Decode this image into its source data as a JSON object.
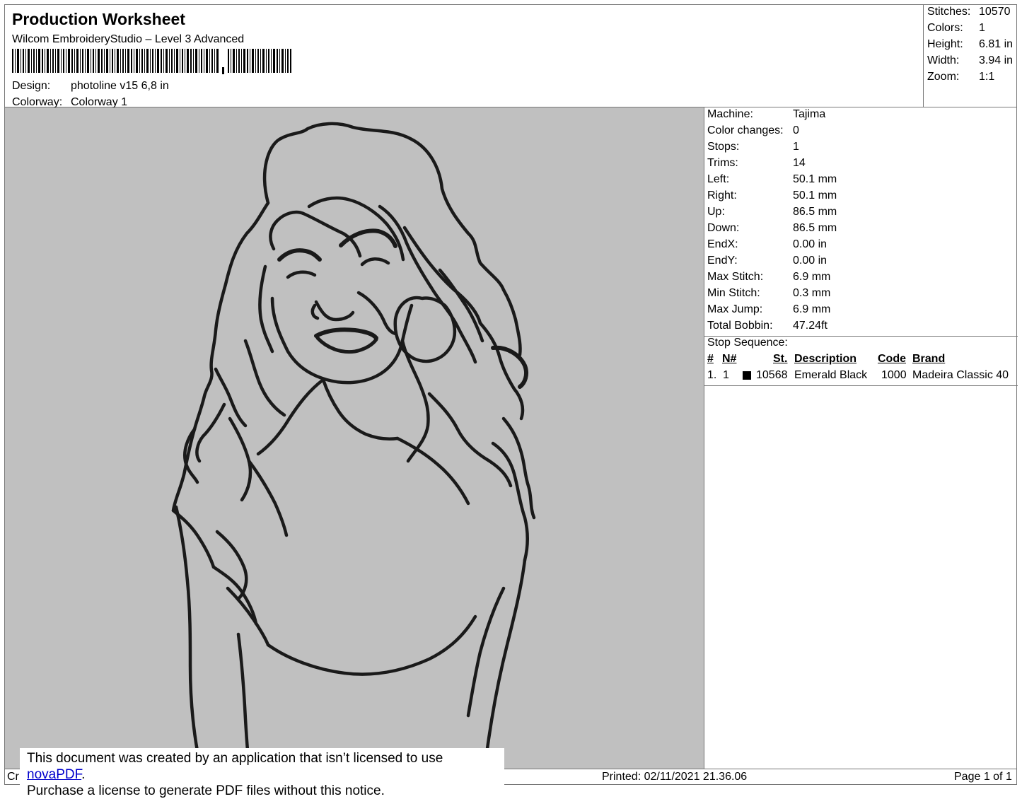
{
  "header": {
    "title": "Production Worksheet",
    "software": "Wilcom EmbroideryStudio – Level 3 Advanced",
    "design_label": "Design:",
    "design_value": "photoline v15 6,8 in",
    "colorway_label": "Colorway:",
    "colorway_value": "Colorway 1"
  },
  "stats": [
    {
      "label": "Stitches:",
      "value": "10570"
    },
    {
      "label": "Colors:",
      "value": "1"
    },
    {
      "label": "Height:",
      "value": "6.81 in"
    },
    {
      "label": "Width:",
      "value": "3.94 in"
    },
    {
      "label": "Zoom:",
      "value": "1:1"
    }
  ],
  "machine_info": [
    {
      "label": "Machine:",
      "value": "Tajima"
    },
    {
      "label": "Color changes:",
      "value": "0"
    },
    {
      "label": "Stops:",
      "value": "1"
    },
    {
      "label": "Trims:",
      "value": "14"
    },
    {
      "label": "Left:",
      "value": "50.1 mm"
    },
    {
      "label": "Right:",
      "value": "50.1 mm"
    },
    {
      "label": "Up:",
      "value": "86.5 mm"
    },
    {
      "label": "Down:",
      "value": "86.5 mm"
    },
    {
      "label": "EndX:",
      "value": "0.00 in"
    },
    {
      "label": "EndY:",
      "value": "0.00 in"
    },
    {
      "label": "Max Stitch:",
      "value": "6.9 mm"
    },
    {
      "label": "Min Stitch:",
      "value": "0.3 mm"
    },
    {
      "label": "Max Jump:",
      "value": "6.9 mm"
    },
    {
      "label": "Total Bobbin:",
      "value": "47.24ft"
    }
  ],
  "stop_sequence": {
    "label": "Stop Sequence:",
    "columns": {
      "num": "#",
      "n": "N#",
      "st": "St.",
      "description": "Description",
      "code": "Code",
      "brand": "Brand"
    },
    "rows": [
      {
        "num": "1.",
        "n": "1",
        "swatch_color": "#000000",
        "st": "10568",
        "description": "Emerald Black",
        "code": "1000",
        "brand": "Madeira Classic 40"
      }
    ]
  },
  "design_preview": {
    "background": "#c0c0c0",
    "stitch_color": "#1a1a1a"
  },
  "footer": {
    "left_text": "Cr",
    "printed": "Printed: 02/11/2021 21.36.06",
    "page": "Page 1 of 1"
  },
  "notice": {
    "line1_prefix": "This document was created by an application that isn’t licensed to use ",
    "link_text": "novaPDF",
    "line1_suffix": ".",
    "line2": "Purchase a license to generate PDF files without this notice."
  }
}
